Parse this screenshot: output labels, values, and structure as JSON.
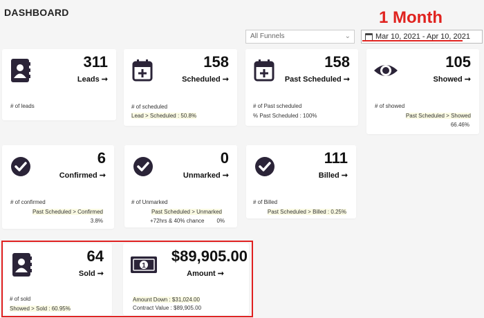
{
  "page": {
    "title": "DASHBOARD",
    "annotation": "1 Month"
  },
  "filters": {
    "funnel_value": "All Funnels",
    "date_range": "Mar 10, 2021 - Apr 10, 2021"
  },
  "cards": {
    "leads": {
      "value": "311",
      "label": "Leads ➞",
      "sub1": "# of leads"
    },
    "scheduled": {
      "value": "158",
      "label": "Scheduled ➞",
      "sub1": "# of scheduled",
      "sub2": "Lead > Scheduled : 50.8%"
    },
    "past_scheduled": {
      "value": "158",
      "label": "Past Scheduled ➞",
      "sub1": "# of Past scheduled",
      "sub2": "% Past Scheduled : 100%"
    },
    "showed": {
      "value": "105",
      "label": "Showed ➞",
      "sub1": "# of showed",
      "sub2": "Past Scheduled > Showed",
      "sub3": "66.46%"
    },
    "confirmed": {
      "value": "6",
      "label": "Confirmed ➞",
      "sub1": "# of confirmed",
      "sub2": "Past Scheduled > Confirmed",
      "sub3": "3.8%"
    },
    "unmarked": {
      "value": "0",
      "label": "Unmarked ➞",
      "sub1": "# of Unmarked",
      "sub2": "Past Scheduled > Unmarked",
      "sub3": "+72hrs & 40% chance",
      "sub4": "0%"
    },
    "billed": {
      "value": "111",
      "label": "Billed ➞",
      "sub1": "# of Billed",
      "sub2": "Past Scheduled > Billed : 0.25%"
    },
    "sold": {
      "value": "64",
      "label": "Sold ➞",
      "sub1": "# of sold",
      "sub2": "Showed > Sold : 60.95%"
    },
    "amount": {
      "value": "$89,905.00",
      "label": "Amount ➞",
      "sub1": "Amount Down : $31,024.00",
      "sub2": "Contract Value : $89,905.00"
    }
  },
  "colors": {
    "icon": "#2b2438",
    "accent_red": "#e0231f",
    "highlight": "#fbfbe4"
  }
}
